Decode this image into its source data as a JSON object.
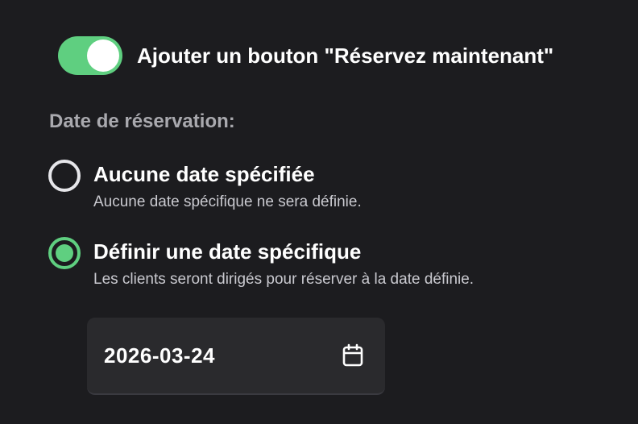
{
  "booking_toggle": {
    "label": "Ajouter un bouton \"Réservez maintenant\"",
    "enabled": true,
    "accent_color": "#5fcf80"
  },
  "booking_date": {
    "section_label": "Date de réservation:",
    "options": [
      {
        "title": "Aucune date spécifiée",
        "description": "Aucune date spécifique ne sera définie.",
        "selected": false
      },
      {
        "title": "Définir une date spécifique",
        "description": "Les clients seront dirigés pour réserver à la date définie.",
        "selected": true
      }
    ],
    "date_input": {
      "value": "2026-03-24",
      "icon": "calendar-icon"
    }
  }
}
